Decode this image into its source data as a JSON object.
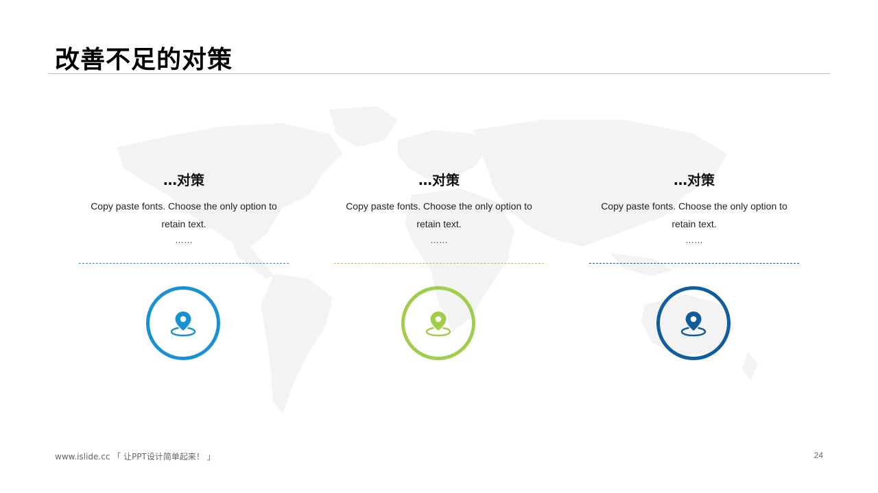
{
  "slide": {
    "title": "改善不足的对策"
  },
  "cards": [
    {
      "heading": "…对策",
      "body": "Copy paste fonts. Choose the only option to retain text.",
      "ellipsis": "……",
      "color": "#1a90d5",
      "icon": "location-pin-icon"
    },
    {
      "heading": "…对策",
      "body": "Copy paste fonts. Choose the only option to retain text.",
      "ellipsis": "……",
      "color": "#a0cd4a",
      "icon": "location-pin-icon"
    },
    {
      "heading": "…对策",
      "body": "Copy paste fonts. Choose the only option to retain text.",
      "ellipsis": "……",
      "color": "#0f5d9c",
      "icon": "location-pin-icon"
    }
  ],
  "footer": {
    "brand": "www.islide.cc 「 让PPT设计简单起来！ 」",
    "page_number": "24"
  },
  "background": {
    "map_color": "#f3f3f3"
  }
}
